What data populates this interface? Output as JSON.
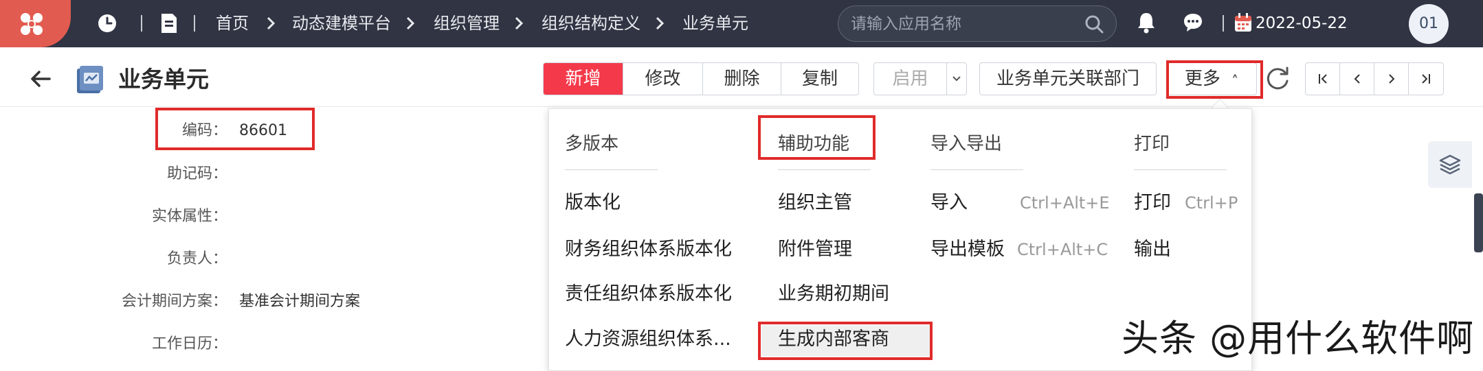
{
  "nav": {
    "breadcrumbs": [
      "首页",
      "动态建模平台",
      "组织管理",
      "组织结构定义",
      "业务单元"
    ],
    "search_placeholder": "请输入应用名称",
    "date": "2022-05-22",
    "user": "01"
  },
  "page": {
    "title": "业务单元"
  },
  "toolbar": {
    "group1": [
      "新增",
      "修改",
      "删除",
      "复制"
    ],
    "enable": "启用",
    "link_dept": "业务单元关联部门",
    "more": "更多",
    "more_caret": "˄"
  },
  "form": {
    "fields": [
      {
        "label": "编码：",
        "value": "86601"
      },
      {
        "label": "助记码：",
        "value": ""
      },
      {
        "label": "实体属性：",
        "value": ""
      },
      {
        "label": "负责人：",
        "value": ""
      },
      {
        "label": "会计期间方案：",
        "value": "基准会计期间方案"
      },
      {
        "label": "工作日历：",
        "value": ""
      }
    ]
  },
  "menu": {
    "col1": {
      "heading": "多版本",
      "items": [
        "版本化",
        "财务组织体系版本化",
        "责任组织体系版本化",
        "人力资源组织体系..."
      ]
    },
    "col2": {
      "heading": "辅助功能",
      "items": [
        "组织主管",
        "附件管理",
        "业务期初期间",
        "生成内部客商"
      ]
    },
    "col3": {
      "heading": "导入导出",
      "items": [
        {
          "label": "导入",
          "shortcut": "Ctrl+Alt+E"
        },
        {
          "label": "导出模板",
          "shortcut": "Ctrl+Alt+C"
        }
      ]
    },
    "col4": {
      "heading": "打印",
      "items": [
        {
          "label": "打印",
          "shortcut": "Ctrl+P"
        },
        {
          "label": "输出",
          "shortcut": ""
        }
      ]
    }
  },
  "watermark": "头条 @用什么软件啊",
  "colors": {
    "topbar": "#303443",
    "logo": "#e25b50",
    "primary": "#f4394a",
    "highlight": "#e02a2a"
  },
  "icons": [
    "logo-icon",
    "clock-icon",
    "doc-icon",
    "search-icon",
    "bell-icon",
    "chat-icon",
    "calendar-icon",
    "back-icon",
    "page-icon",
    "refresh-icon",
    "layers-icon"
  ]
}
